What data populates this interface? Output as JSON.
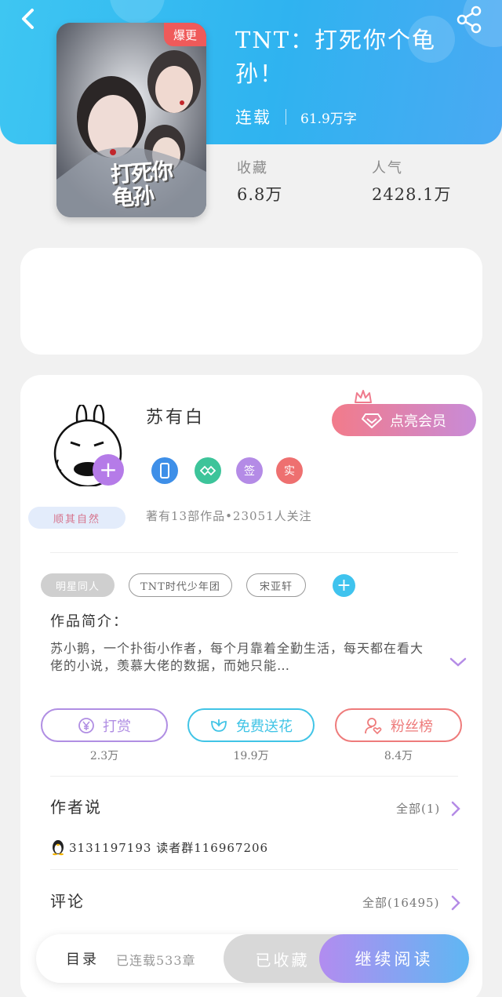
{
  "header": {
    "title": "TNT：打死你个龟孙！",
    "status": "连载",
    "word_count": "61.9万字",
    "stats": [
      {
        "label": "收藏",
        "value": "6.8万"
      },
      {
        "label": "人气",
        "value": "2428.1万"
      }
    ],
    "cover_badge": "爆更",
    "cover_title_art": "打死你 龟孙"
  },
  "author": {
    "name": "苏有白",
    "tag": "顺其自然",
    "vip_button": "点亮会员",
    "badges": [
      "签",
      "实"
    ],
    "stats": "著有13部作品•23051人关注"
  },
  "tags": [
    "明星同人",
    "TNT时代少年团",
    "宋亚轩"
  ],
  "intro": {
    "label": "作品简介：",
    "text": "苏小鹅，一个扑街小作者，每个月靠着全勤生活，每天都在看大佬的小说，羡慕大佬的数据，而她只能…"
  },
  "actions": [
    {
      "label": "打赏",
      "count": "2.3万",
      "color": "#b08ee3"
    },
    {
      "label": "免费送花",
      "count": "19.9万",
      "color": "#41c4e6"
    },
    {
      "label": "粉丝榜",
      "count": "8.4万",
      "color": "#ee7b7b"
    }
  ],
  "author_says": {
    "title": "作者说",
    "link": "全部(1)",
    "content": "3131197193 读者群116967206"
  },
  "comments": {
    "title": "评论",
    "link": "全部(16495)"
  },
  "bottom_bar": {
    "toc_label": "目录",
    "toc_info": "已连载533章",
    "favorite": "已收藏",
    "read": "继续阅读"
  },
  "colors": {
    "header_gradient": [
      "#3ec6f2",
      "#4aa9f3"
    ],
    "vip_gradient": [
      "#f27b8a",
      "#c88bd8"
    ],
    "read_gradient": [
      "#b28cf0",
      "#5fb7f3"
    ]
  }
}
